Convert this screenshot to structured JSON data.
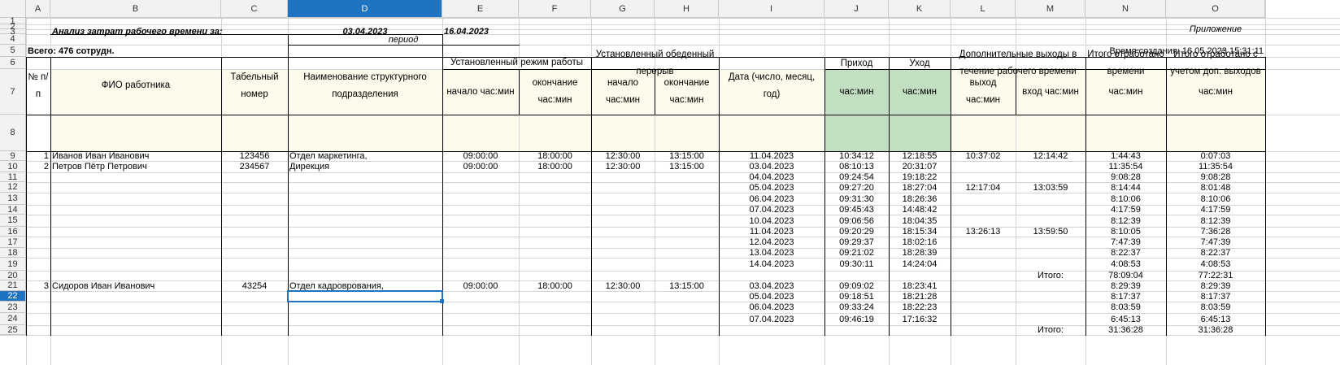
{
  "columns": [
    "A",
    "B",
    "C",
    "D",
    "E",
    "F",
    "G",
    "H",
    "I",
    "J",
    "K",
    "L",
    "M",
    "N",
    "O"
  ],
  "active_column": "D",
  "active_row": "22",
  "rows": [
    "1",
    "2",
    "3",
    "4",
    "5",
    "6",
    "7",
    "8",
    "9",
    "10",
    "11",
    "12",
    "13",
    "14",
    "15",
    "16",
    "17",
    "18",
    "19",
    "20",
    "21",
    "22",
    "23",
    "24",
    "25"
  ],
  "header": {
    "appendix": "Приложение",
    "title": "Анализ затрат рабочего времени за:",
    "date_from": "03.04.2023",
    "date_to": "16.04.2023",
    "period": "период",
    "total_staff": "Всего: 476 сотрудн.",
    "created": "Время создания: 16.05.2023 15:31:11"
  },
  "table_header": {
    "num": "№ п/п",
    "fio": "ФИО работника",
    "tab": "Табельный номер",
    "dept": "Наименование структурного подразделения",
    "regime": "Установленный режим работы",
    "regime_start": "начало час:мин",
    "regime_end": "окончание час:мин",
    "lunch": "Установленный обеденный перерыв",
    "lunch_start": "начало час:мин",
    "lunch_end": "окончание час:мин",
    "date": "Дата (число, месяц, год)",
    "arrival": "Приход",
    "arrival_unit": "час:мин",
    "leave": "Уход",
    "leave_unit": "час:мин",
    "extra": "Дополнительные выходы в течение рабочего времени",
    "extra_out": "выход час:мин",
    "extra_in": "вход час:мин",
    "total": "Итого отработано времени",
    "total_unit": "час:мин",
    "total_adj": "Итого отработано с учетом доп. выходов",
    "total_adj_unit": "час:мин"
  },
  "employees": [
    {
      "num": "1",
      "name": "Иванов Иван Иванович",
      "tab": "123456",
      "dept": "Отдел маркетинга,",
      "start": "09:00:00",
      "end": "18:00:00",
      "lstart": "12:30:00",
      "lend": "13:15:00"
    },
    {
      "num": "2",
      "name": "Петров Пётр Петрович",
      "tab": "234567",
      "dept": "Дирекция",
      "start": "09:00:00",
      "end": "18:00:00",
      "lstart": "12:30:00",
      "lend": "13:15:00"
    },
    {
      "num": "3",
      "name": "Сидоров Иван Иванович",
      "tab": "43254",
      "dept": "Отдел кадроврования,",
      "start": "09:00:00",
      "end": "18:00:00",
      "lstart": "12:30:00",
      "lend": "13:15:00"
    }
  ],
  "days": [
    {
      "date": "11.04.2023",
      "in": "10:34:12",
      "out": "12:18:55",
      "xout": "10:37:02",
      "xin": "12:14:42",
      "total": "1:44:43",
      "adj": "0:07:03"
    },
    {
      "date": "03.04.2023",
      "in": "08:10:13",
      "out": "20:31:07",
      "xout": "",
      "xin": "",
      "total": "11:35:54",
      "adj": "11:35:54"
    },
    {
      "date": "04.04.2023",
      "in": "09:24:54",
      "out": "19:18:22",
      "xout": "",
      "xin": "",
      "total": "9:08:28",
      "adj": "9:08:28"
    },
    {
      "date": "05.04.2023",
      "in": "09:27:20",
      "out": "18:27:04",
      "xout": "12:17:04",
      "xin": "13:03:59",
      "total": "8:14:44",
      "adj": "8:01:48"
    },
    {
      "date": "06.04.2023",
      "in": "09:31:30",
      "out": "18:26:36",
      "xout": "",
      "xin": "",
      "total": "8:10:06",
      "adj": "8:10:06"
    },
    {
      "date": "07.04.2023",
      "in": "09:45:43",
      "out": "14:48:42",
      "xout": "",
      "xin": "",
      "total": "4:17:59",
      "adj": "4:17:59"
    },
    {
      "date": "10.04.2023",
      "in": "09:06:56",
      "out": "18:04:35",
      "xout": "",
      "xin": "",
      "total": "8:12:39",
      "adj": "8:12:39"
    },
    {
      "date": "11.04.2023",
      "in": "09:20:29",
      "out": "18:15:34",
      "xout": "13:26:13",
      "xin": "13:59:50",
      "total": "8:10:05",
      "adj": "7:36:28"
    },
    {
      "date": "12.04.2023",
      "in": "09:29:37",
      "out": "18:02:16",
      "xout": "",
      "xin": "",
      "total": "7:47:39",
      "adj": "7:47:39"
    },
    {
      "date": "13.04.2023",
      "in": "09:21:02",
      "out": "18:28:39",
      "xout": "",
      "xin": "",
      "total": "8:22:37",
      "adj": "8:22:37"
    },
    {
      "date": "14.04.2023",
      "in": "09:30:11",
      "out": "14:24:04",
      "xout": "",
      "xin": "",
      "total": "4:08:53",
      "adj": "4:08:53"
    },
    {
      "date": "",
      "in": "",
      "out": "",
      "xout": "",
      "xin": "Итого:",
      "total": "78:09:04",
      "adj": "77:22:31"
    },
    {
      "date": "03.04.2023",
      "in": "09:09:02",
      "out": "18:23:41",
      "xout": "",
      "xin": "",
      "total": "8:29:39",
      "adj": "8:29:39"
    },
    {
      "date": "05.04.2023",
      "in": "09:18:51",
      "out": "18:21:28",
      "xout": "",
      "xin": "",
      "total": "8:17:37",
      "adj": "8:17:37"
    },
    {
      "date": "06.04.2023",
      "in": "09:33:24",
      "out": "18:22:23",
      "xout": "",
      "xin": "",
      "total": "8:03:59",
      "adj": "8:03:59"
    },
    {
      "date": "07.04.2023",
      "in": "09:46:19",
      "out": "17:16:32",
      "xout": "",
      "xin": "",
      "total": "6:45:13",
      "adj": "6:45:13"
    },
    {
      "date": "",
      "in": "",
      "out": "",
      "xout": "",
      "xin": "Итого:",
      "total": "31:36:28",
      "adj": "31:36:28"
    }
  ],
  "colors": {
    "header_fill": "#fdfbeb",
    "green_fill": "#c2dfc2",
    "selection": "#1e73c2"
  }
}
